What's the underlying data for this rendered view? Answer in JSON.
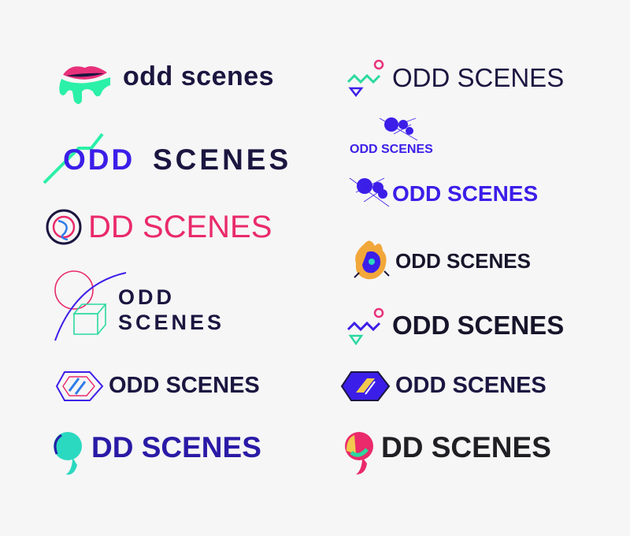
{
  "logos": [
    {
      "wordmark": "odd scenes",
      "icon": "lips-drip-icon",
      "text_color": "#1b1640",
      "accent": "#e8317a"
    },
    {
      "wordmark": "ODD SCENES",
      "icon": "zigzag-circle-triangle-icon",
      "text_color": "#1b1640",
      "accent": "#2bd9a0"
    },
    {
      "wordmark": "ODD",
      "wordmark_2": "SCENES",
      "icon": "diagonal-slash-icon",
      "text_color": "#1b1640",
      "accent": "#3b1ee8"
    },
    {
      "wordmark": "ODD SCENES",
      "icon": "dot-scribble-icon",
      "text_color": "#3b1ee8",
      "accent": "#3b1ee8"
    },
    {
      "wordmark": "ODD SCENES",
      "icon": "dot-scribble-icon",
      "text_color": "#3b1ee8",
      "accent": "#3b1ee8"
    },
    {
      "wordmark": "DD SCENES",
      "icon": "ring-o-icon",
      "text_color": "#ea2a6a",
      "accent": "#2f7ae8"
    },
    {
      "wordmark": "ODD SCENES",
      "icon": "flame-creature-icon",
      "text_color": "#17152a",
      "accent": "#f2a73a"
    },
    {
      "wordmark": "ODD",
      "wordmark_2": "SCENES",
      "icon": "circle-cube-arc-icon",
      "text_color": "#1b1640",
      "accent": "#ea2a6a"
    },
    {
      "wordmark": "ODD SCENES",
      "icon": "zigzag-circle-triangle-icon",
      "text_color": "#17152a",
      "accent": "#2bd9a0"
    },
    {
      "wordmark": "ODD SCENES",
      "icon": "hexagon-outline-icon",
      "text_color": "#1b1640",
      "accent": "#3b1ee8"
    },
    {
      "wordmark": "ODD SCENES",
      "icon": "hexagon-filled-icon",
      "text_color": "#1b1640",
      "accent": "#3b1ee8"
    },
    {
      "wordmark": "DD SCENES",
      "icon": "swirl-o-icon",
      "text_color": "#2a1aa6",
      "accent": "#2bd9c0"
    },
    {
      "wordmark": "DD SCENES",
      "icon": "swirl-o-color-icon",
      "text_color": "#1f1f24",
      "accent": "#ea2a6a"
    }
  ]
}
